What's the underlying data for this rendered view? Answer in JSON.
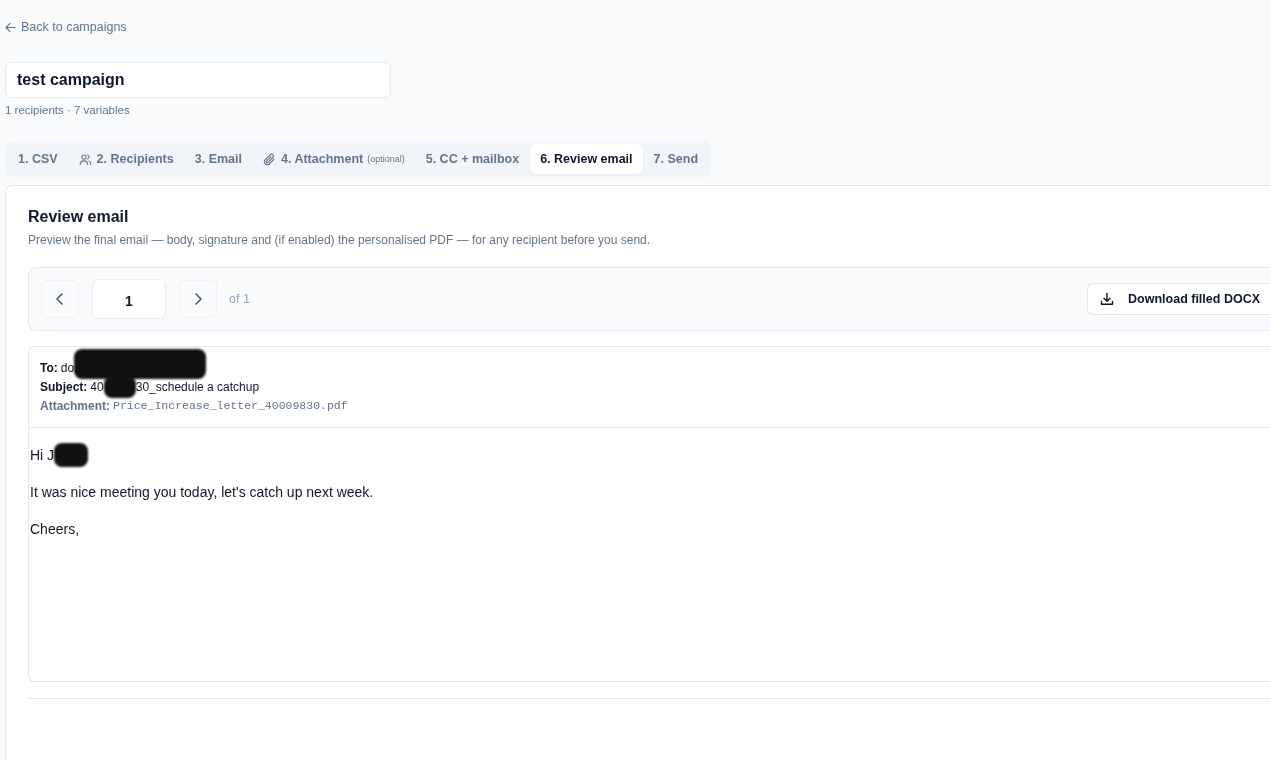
{
  "back_link": {
    "label": "Back to campaigns"
  },
  "campaign": {
    "name": "test campaign",
    "meta": "1 recipients · 7 variables"
  },
  "tabs": [
    {
      "kind": "plain",
      "label": "1. CSV",
      "selected": false
    },
    {
      "kind": "recipients",
      "label": "2. Recipients",
      "selected": false
    },
    {
      "kind": "plain",
      "label": "3. Email",
      "selected": false
    },
    {
      "kind": "attachment",
      "label": "4. Attachment",
      "note": "(optional)",
      "selected": false
    },
    {
      "kind": "plain",
      "label": "5. CC + mailbox",
      "selected": false
    },
    {
      "kind": "plain",
      "label": "6. Review email",
      "selected": true
    },
    {
      "kind": "plain",
      "label": "7. Send",
      "selected": false
    }
  ],
  "review": {
    "title": "Review email",
    "subtitle": "Preview the final email — body, signature and (if enabled) the personalised PDF — for any recipient before you send."
  },
  "pager": {
    "page": "1",
    "total": "of 1",
    "download_button": "Download filled DOCX"
  },
  "email": {
    "headers": [
      {
        "kind": "plain",
        "label": "To:",
        "parts": [
          {
            "kind": "text",
            "text": "do"
          },
          {
            "kind": "redacted"
          }
        ]
      },
      {
        "kind": "plain",
        "label": "Subject:",
        "parts": [
          {
            "kind": "text",
            "text": "40"
          },
          {
            "kind": "redacted"
          },
          {
            "kind": "text",
            "text": "30_schedule a catchup"
          }
        ]
      },
      {
        "kind": "file",
        "label": "Attachment:",
        "parts": [
          {
            "kind": "text",
            "text": "Price_Increase_letter_40009830.pdf"
          }
        ]
      }
    ],
    "body": [
      {
        "parts": [
          {
            "kind": "text",
            "text": "Hi J"
          },
          {
            "kind": "redacted"
          }
        ]
      },
      {
        "parts": [
          {
            "kind": "text",
            "text": "It was nice meeting you today, let's catch up next week."
          }
        ]
      },
      {
        "parts": [
          {
            "kind": "text",
            "text": "Cheers,"
          }
        ]
      }
    ]
  }
}
